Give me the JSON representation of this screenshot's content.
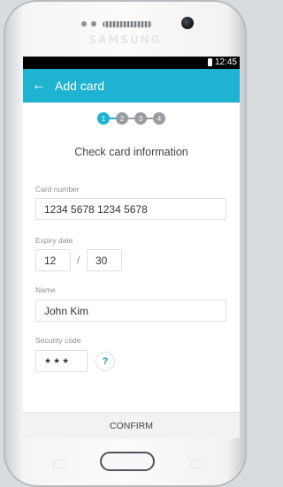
{
  "device": {
    "brand": "SAMSUNG"
  },
  "status_bar": {
    "time": "12:45"
  },
  "app_bar": {
    "back_icon": "arrow-left-icon",
    "back_glyph": "←",
    "title": "Add card"
  },
  "stepper": {
    "steps": [
      "1",
      "2",
      "3",
      "4"
    ],
    "active_step": 1
  },
  "heading": "Check card information",
  "form": {
    "card_number": {
      "label": "Card number",
      "value": "1234  5678  1234  5678"
    },
    "expiry": {
      "label": "Expiry date",
      "month": "12",
      "separator": "/",
      "year": "30"
    },
    "name": {
      "label": "Name",
      "value": "John Kim"
    },
    "security_code": {
      "label": "Security code",
      "value": "★★★",
      "help_icon": "help-icon",
      "help_glyph": "?"
    }
  },
  "confirm_label": "CONFIRM",
  "colors": {
    "accent": "#1eb3d0",
    "status_bar": "#000000",
    "step_inactive": "#9a9da0"
  }
}
